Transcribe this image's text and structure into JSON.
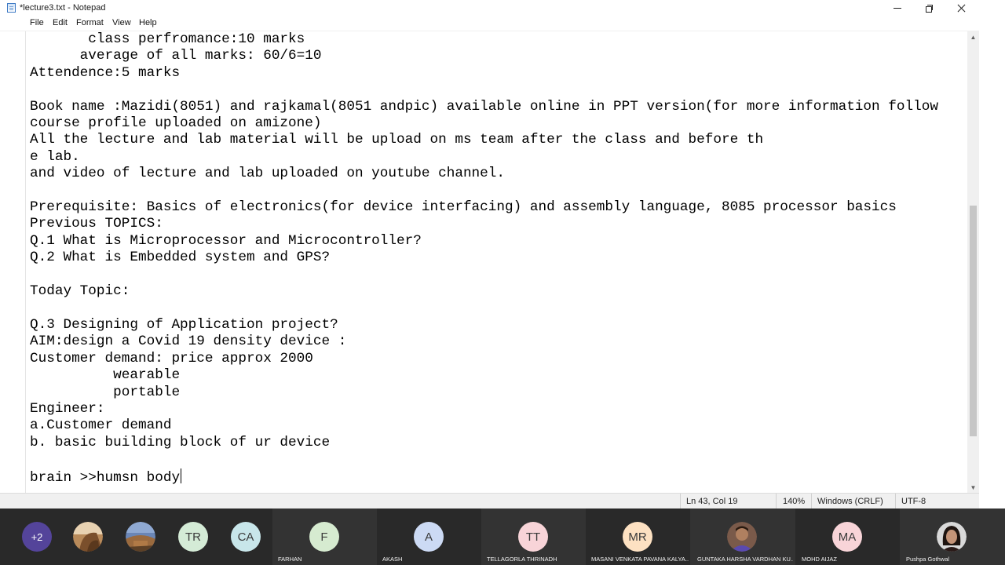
{
  "window": {
    "title": "*lecture3.txt - Notepad"
  },
  "menu": {
    "file": "File",
    "edit": "Edit",
    "format": "Format",
    "view": "View",
    "help": "Help"
  },
  "editor": {
    "text": "       class perfromance:10 marks\n      average of all marks: 60/6=10\nAttendence:5 marks\n\nBook name :Mazidi(8051) and rajkamal(8051 andpic) available online in PPT version(for more information follow\ncourse profile uploaded on amizone)\nAll the lecture and lab material will be upload on ms team after the class and before th\ne lab.\nand video of lecture and lab uploaded on youtube channel.\n\nPrerequisite: Basics of electronics(for device interfacing) and assembly language, 8085 processor basics\nPrevious TOPICS:\nQ.1 What is Microprocessor and Microcontroller?\nQ.2 What is Embedded system and GPS?\n\nToday Topic:\n\nQ.3 Designing of Application project?\nAIM:design a Covid 19 density device :\nCustomer demand: price approx 2000\n          wearable\n          portable\nEngineer:\na.Customer demand\nb. basic building block of ur device\n\nbrain >>humsn body"
  },
  "status": {
    "position": "Ln 43, Col 19",
    "zoom": "140%",
    "line_ending": "Windows (CRLF)",
    "encoding": "UTF-8"
  },
  "participants": {
    "overflow": "+2",
    "p1": {
      "initials": "TR"
    },
    "p2": {
      "initials": "CA"
    },
    "p3": {
      "initials": "F",
      "name": "FARHAN"
    },
    "p4": {
      "initials": "A",
      "name": "AKASH"
    },
    "p5": {
      "initials": "TT",
      "name": "TELLAGORLA THRINADH"
    },
    "p6": {
      "initials": "MR",
      "name": "MASANI VENKATA PAVANA KALYA..."
    },
    "p7": {
      "name": "GUNTAKA HARSHA VARDHAN KU..."
    },
    "p8": {
      "initials": "MA",
      "name": "MOHD AIJAZ"
    },
    "p9": {
      "name": "Pushpa Gothwal"
    }
  },
  "colors": {
    "taskbar": "#292929",
    "tile_active": "#333333",
    "avatar_blue": "#ccdaf4",
    "avatar_pink": "#f8d4d8",
    "avatar_peach": "#fde1c2",
    "avatar_gray": "#d3d3d3",
    "avatar_green": "#d4ebd6",
    "overflow_badge": "#54449a"
  }
}
